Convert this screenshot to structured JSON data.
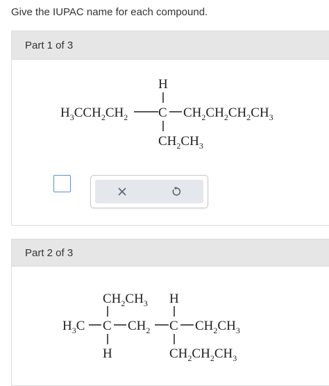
{
  "prompt": "Give the IUPAC name for each compound.",
  "parts": [
    {
      "header": "Part 1 of 3",
      "structure": {
        "top_h": "H",
        "main_left": "H3CCH2CH2",
        "center": "C",
        "main_right": "CH2CH2CH2CH3",
        "bottom": "CH2CH3"
      },
      "answer": {
        "value": ""
      },
      "tools": {
        "clear_icon": "x-icon",
        "reset_icon": "undo-icon"
      }
    },
    {
      "header": "Part 2 of 3",
      "structure": {
        "c1_top": "CH2CH3",
        "c1_bottom": "H",
        "c2_top": "H",
        "c2_bottom": "CH2CH2CH3",
        "left": "H3C",
        "c1": "C",
        "middle": "CH2",
        "c2": "C",
        "right": "CH2CH3"
      }
    }
  ],
  "colors": {
    "header_bg": "#e6e6e6",
    "answer_border": "#5a8fd0",
    "tool_bg": "#e4e7eb"
  }
}
